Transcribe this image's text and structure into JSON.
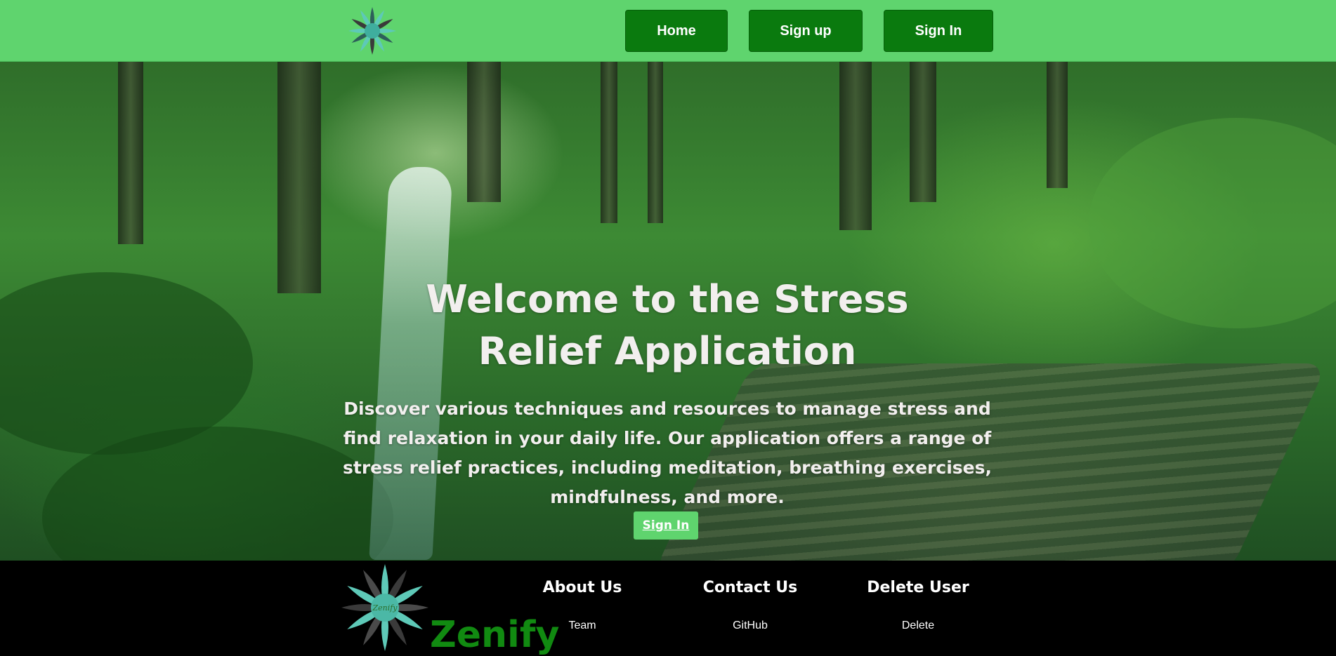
{
  "header": {
    "logo_icon": "zenify-flower-logo-icon",
    "nav": {
      "home_label": "Home",
      "signup_label": "Sign up",
      "signin_label": "Sign In"
    },
    "colors": {
      "bar": "#5fd46e",
      "button": "#0a7a0e"
    }
  },
  "hero": {
    "background": "forest-waterfall-boardwalk-image",
    "title": "Welcome to the Stress Relief Application",
    "description": "Discover various techniques and resources to manage stress and find relaxation in your daily life. Our application offers a range of stress relief practices, including meditation, breathing exercises, mindfulness, and more.",
    "cta_label": "Sign In"
  },
  "footer": {
    "logo_icon": "zenify-flower-logo-icon",
    "logo_text": "Zenify",
    "brand": "Zenify",
    "columns": [
      {
        "heading": "About Us",
        "link": "Team"
      },
      {
        "heading": "Contact Us",
        "link": "GitHub"
      },
      {
        "heading": "Delete User",
        "link": "Delete"
      }
    ]
  }
}
